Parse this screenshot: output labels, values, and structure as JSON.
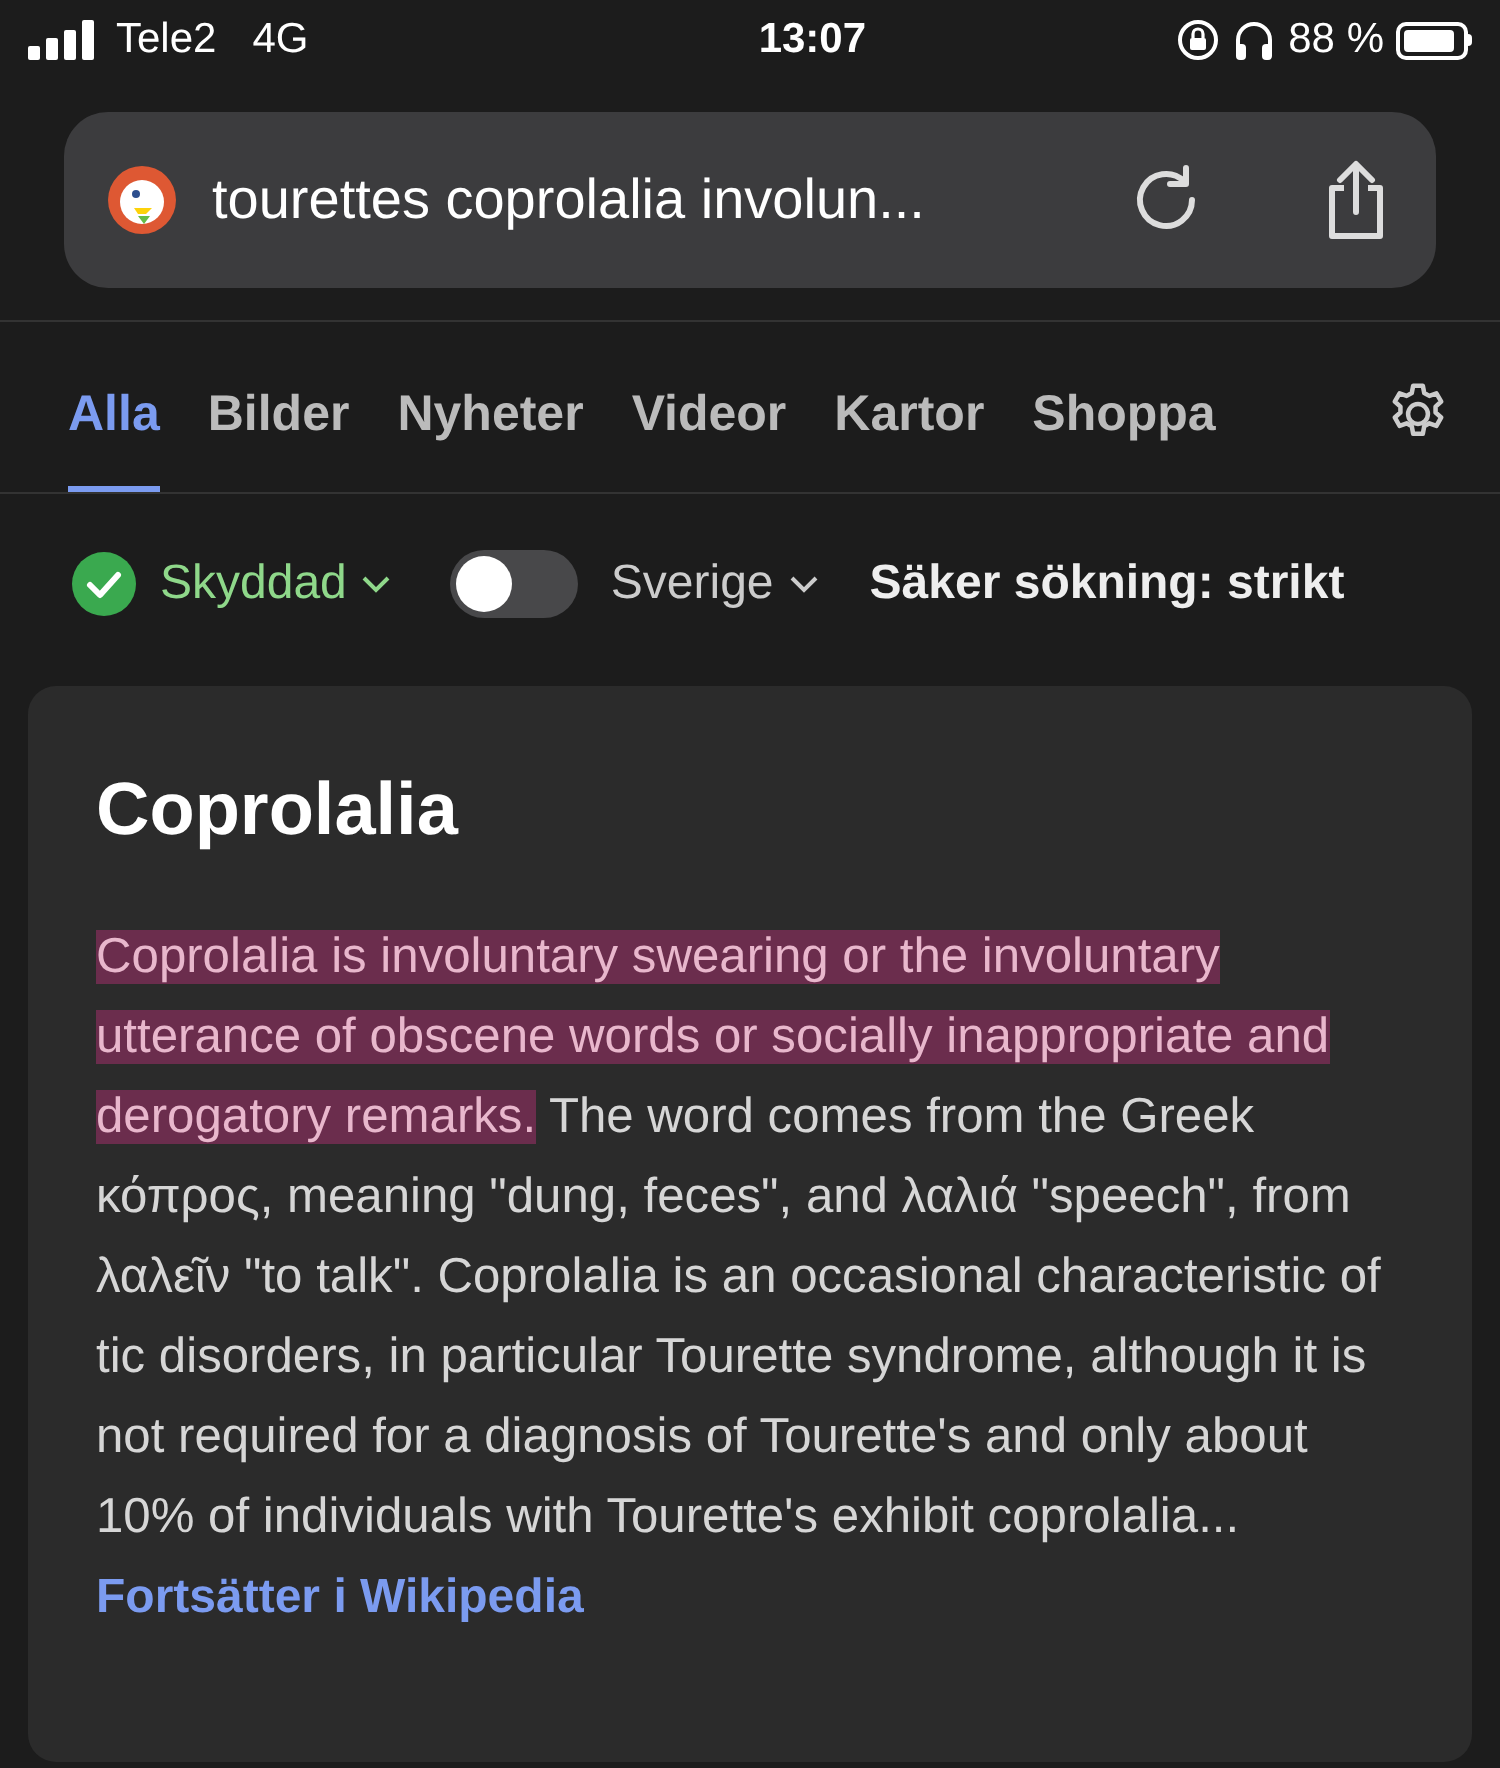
{
  "status_bar": {
    "carrier": "Tele2",
    "network": "4G",
    "time": "13:07",
    "battery": "88 %"
  },
  "address_bar": {
    "query": "tourettes coprolalia involun..."
  },
  "tabs": [
    {
      "label": "Alla",
      "selected": true
    },
    {
      "label": "Bilder",
      "selected": false
    },
    {
      "label": "Nyheter",
      "selected": false
    },
    {
      "label": "Videor",
      "selected": false
    },
    {
      "label": "Kartor",
      "selected": false
    },
    {
      "label": "Shoppa",
      "selected": false
    }
  ],
  "filters": {
    "protection": "Skyddad",
    "region_toggle_on": false,
    "region": "Sverige",
    "safe_search": "Säker sökning: strikt"
  },
  "result": {
    "title": "Coprolalia",
    "highlighted": "Coprolalia is involuntary swearing or the involuntary utterance of obscene words or socially inappropriate and derogatory remarks.",
    "text": " The word comes from the Greek κόπρος, meaning \"dung, feces\", and λαλιά \"speech\", from λαλεῖν \"to talk\". Coprolalia is an occasional characteristic of tic disorders, in particular Tourette syndrome, although it is not required for a diagnosis of Tourette's and only about 10% of individuals with Tourette's exhibit coprolalia...",
    "link": "Fortsätter i Wikipedia"
  }
}
